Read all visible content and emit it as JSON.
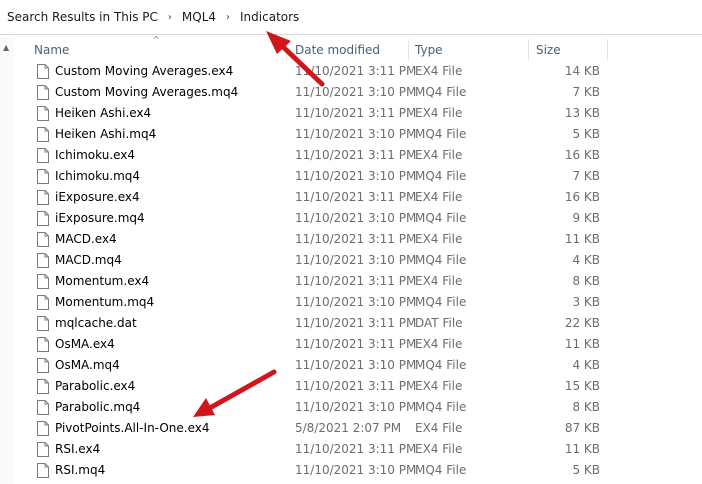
{
  "breadcrumb": {
    "items": [
      "Search Results in This PC",
      "MQL4",
      "Indicators"
    ],
    "separator": "›"
  },
  "columns": {
    "name": "Name",
    "date": "Date modified",
    "type": "Type",
    "size": "Size"
  },
  "files": [
    {
      "name": "Custom Moving Averages.ex4",
      "date": "11/10/2021 3:11 PM",
      "type": "EX4 File",
      "size": "14 KB"
    },
    {
      "name": "Custom Moving Averages.mq4",
      "date": "11/10/2021 3:10 PM",
      "type": "MQ4 File",
      "size": "7 KB"
    },
    {
      "name": "Heiken Ashi.ex4",
      "date": "11/10/2021 3:11 PM",
      "type": "EX4 File",
      "size": "13 KB"
    },
    {
      "name": "Heiken Ashi.mq4",
      "date": "11/10/2021 3:10 PM",
      "type": "MQ4 File",
      "size": "5 KB"
    },
    {
      "name": "Ichimoku.ex4",
      "date": "11/10/2021 3:11 PM",
      "type": "EX4 File",
      "size": "16 KB"
    },
    {
      "name": "Ichimoku.mq4",
      "date": "11/10/2021 3:10 PM",
      "type": "MQ4 File",
      "size": "7 KB"
    },
    {
      "name": "iExposure.ex4",
      "date": "11/10/2021 3:11 PM",
      "type": "EX4 File",
      "size": "16 KB"
    },
    {
      "name": "iExposure.mq4",
      "date": "11/10/2021 3:10 PM",
      "type": "MQ4 File",
      "size": "9 KB"
    },
    {
      "name": "MACD.ex4",
      "date": "11/10/2021 3:11 PM",
      "type": "EX4 File",
      "size": "11 KB"
    },
    {
      "name": "MACD.mq4",
      "date": "11/10/2021 3:10 PM",
      "type": "MQ4 File",
      "size": "4 KB"
    },
    {
      "name": "Momentum.ex4",
      "date": "11/10/2021 3:11 PM",
      "type": "EX4 File",
      "size": "8 KB"
    },
    {
      "name": "Momentum.mq4",
      "date": "11/10/2021 3:10 PM",
      "type": "MQ4 File",
      "size": "3 KB"
    },
    {
      "name": "mqlcache.dat",
      "date": "11/10/2021 3:11 PM",
      "type": "DAT File",
      "size": "22 KB"
    },
    {
      "name": "OsMA.ex4",
      "date": "11/10/2021 3:11 PM",
      "type": "EX4 File",
      "size": "11 KB"
    },
    {
      "name": "OsMA.mq4",
      "date": "11/10/2021 3:10 PM",
      "type": "MQ4 File",
      "size": "4 KB"
    },
    {
      "name": "Parabolic.ex4",
      "date": "11/10/2021 3:11 PM",
      "type": "EX4 File",
      "size": "15 KB"
    },
    {
      "name": "Parabolic.mq4",
      "date": "11/10/2021 3:10 PM",
      "type": "MQ4 File",
      "size": "8 KB"
    },
    {
      "name": "PivotPoints.All-In-One.ex4",
      "date": "5/8/2021 2:07 PM",
      "type": "EX4 File",
      "size": "87 KB"
    },
    {
      "name": "RSI.ex4",
      "date": "11/10/2021 3:11 PM",
      "type": "EX4 File",
      "size": "11 KB"
    },
    {
      "name": "RSI.mq4",
      "date": "11/10/2021 3:10 PM",
      "type": "MQ4 File",
      "size": "5 KB"
    }
  ],
  "icons": {
    "file": "file-icon",
    "sort": "sort-ascending-icon",
    "separator": "chevron-right-icon"
  },
  "colors": {
    "header_text": "#4c607a",
    "secondary_text": "#6d6d6d",
    "annotation_arrow": "#d0161b"
  }
}
